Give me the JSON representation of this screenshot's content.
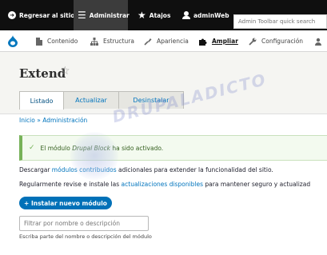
{
  "toolbar": {
    "back_label": "Regresar al sitio",
    "admin_label": "Administrar",
    "shortcuts_label": "Atajos",
    "user_label": "adminWeb",
    "search_placeholder": "Admin Toolbar quick search"
  },
  "tray": {
    "items": [
      {
        "label": "Contenido",
        "icon": "document-icon"
      },
      {
        "label": "Estructura",
        "icon": "sitemap-icon"
      },
      {
        "label": "Apariencia",
        "icon": "paintbrush-icon"
      },
      {
        "label": "Ampliar",
        "icon": "puzzle-icon",
        "active": true
      },
      {
        "label": "Configuración",
        "icon": "wrench-icon"
      }
    ]
  },
  "page": {
    "title": "Extend",
    "tabs": [
      {
        "label": "Listado",
        "active": true
      },
      {
        "label": "Actualizar"
      },
      {
        "label": "Desinstalar"
      }
    ]
  },
  "breadcrumb": {
    "home": "Inicio",
    "separator": "»",
    "admin": "Administración"
  },
  "status": {
    "prefix": "El módulo ",
    "module": "Drupal Block",
    "suffix": " ha sido activado."
  },
  "intro": {
    "p1_before": "Descargar ",
    "p1_link": "módulos contribuidos",
    "p1_after": " adicionales para extender la funcionalidad del sitio.",
    "p2_before": "Regularmente revise e instale las ",
    "p2_link": "actualizaciones disponibles",
    "p2_after": " para mantener seguro y actualizad"
  },
  "actions": {
    "add_module": "+ Instalar nuevo módulo"
  },
  "filter": {
    "placeholder": "Filtrar por nombre o descripción",
    "description": "Escriba parte del nombre o descripción del módulo"
  },
  "watermark": {
    "text": "DRUPALADICTO"
  },
  "colors": {
    "toolbar_bg": "#0f0f0f",
    "link": "#0074bd",
    "primary_button": "#0071b8",
    "status_green": "#77b259"
  }
}
